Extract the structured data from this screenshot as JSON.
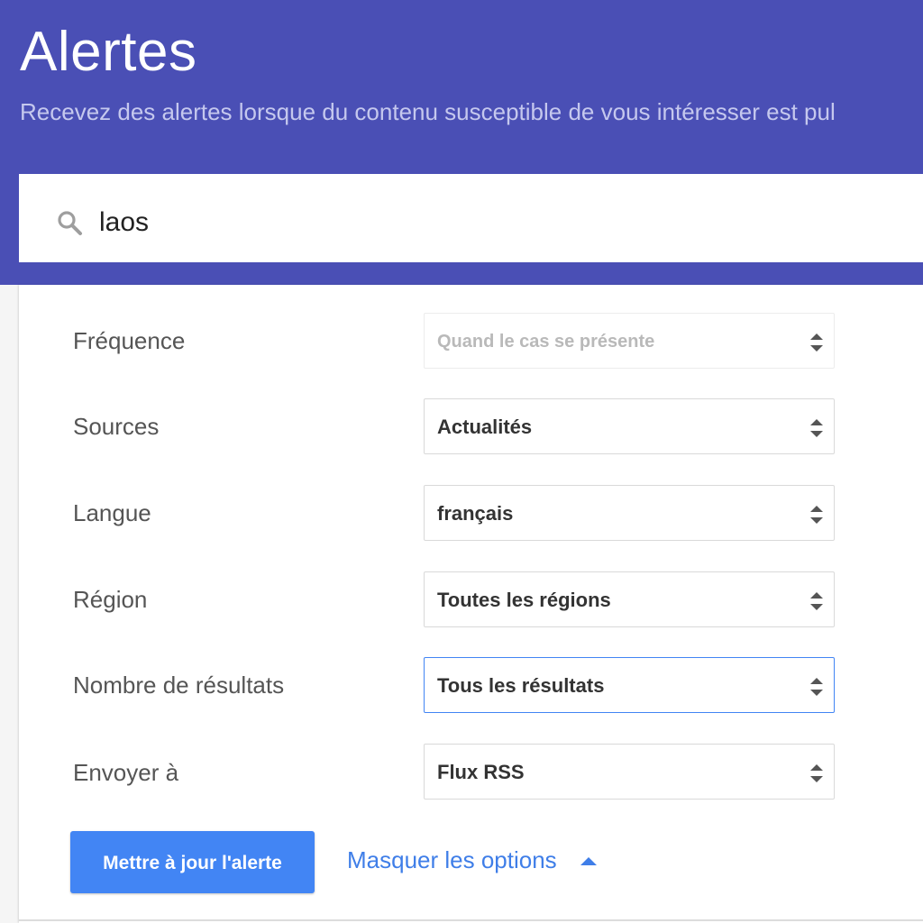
{
  "header": {
    "title": "Alertes",
    "subtitle": "Recevez des alertes lorsque du contenu susceptible de vous intéresser est pul"
  },
  "search": {
    "icon": "search-icon",
    "value": "laos"
  },
  "options": [
    {
      "label": "Fréquence",
      "value": "Quand le cas se présente",
      "state": "disabled"
    },
    {
      "label": "Sources",
      "value": "Actualités",
      "state": "normal"
    },
    {
      "label": "Langue",
      "value": "français",
      "state": "normal"
    },
    {
      "label": "Région",
      "value": "Toutes les régions",
      "state": "normal"
    },
    {
      "label": "Nombre de résultats",
      "value": "Tous les résultats",
      "state": "focused"
    },
    {
      "label": "Envoyer à",
      "value": "Flux RSS",
      "state": "normal"
    }
  ],
  "actions": {
    "update_label": "Mettre à jour l'alerte",
    "toggle_label": "Masquer les options",
    "toggle_icon": "caret-up-icon"
  },
  "colors": {
    "header_bg": "#4a4fb5",
    "accent": "#4285f4",
    "link": "#3f7ee8"
  }
}
